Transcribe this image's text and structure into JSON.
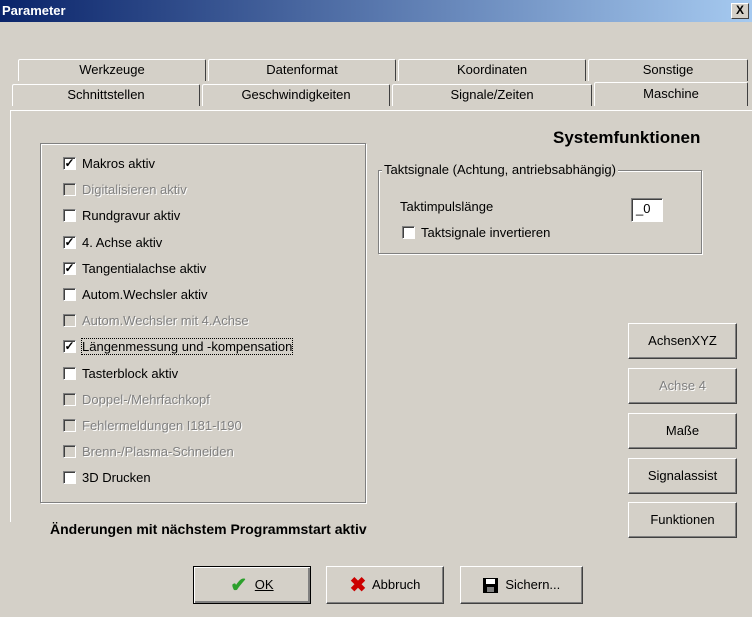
{
  "window": {
    "title": "Parameter",
    "close_glyph": "X"
  },
  "tabs_row1": [
    {
      "label": "Werkzeuge"
    },
    {
      "label": "Datenformat"
    },
    {
      "label": "Koordinaten"
    },
    {
      "label": "Sonstige"
    }
  ],
  "tabs_row2": [
    {
      "label": "Schnittstellen"
    },
    {
      "label": "Geschwindigkeiten"
    },
    {
      "label": "Signale/Zeiten"
    },
    {
      "label": "Maschine",
      "active": true
    }
  ],
  "section_title": "Systemfunktionen",
  "checkboxes": [
    {
      "label": "Makros aktiv",
      "checked": true,
      "enabled": true
    },
    {
      "label": "Digitalisieren aktiv",
      "checked": false,
      "enabled": false
    },
    {
      "label": "Rundgravur aktiv",
      "checked": false,
      "enabled": true
    },
    {
      "label": "4. Achse aktiv",
      "checked": true,
      "enabled": true
    },
    {
      "label": "Tangentialachse aktiv",
      "checked": true,
      "enabled": true
    },
    {
      "label": "Autom.Wechsler aktiv",
      "checked": false,
      "enabled": true
    },
    {
      "label": "Autom.Wechsler mit 4.Achse",
      "checked": false,
      "enabled": false
    },
    {
      "label": "Längenmessung und -kompensation",
      "checked": true,
      "enabled": true,
      "focused": true
    },
    {
      "label": "Tasterblock aktiv",
      "checked": false,
      "enabled": true
    },
    {
      "label": "Doppel-/Mehrfachkopf",
      "checked": false,
      "enabled": false
    },
    {
      "label": "Fehlermeldungen I181-I190",
      "checked": false,
      "enabled": false
    },
    {
      "label": "Brenn-/Plasma-Schneiden",
      "checked": false,
      "enabled": false
    },
    {
      "label": "3D Drucken",
      "checked": false,
      "enabled": true
    }
  ],
  "takt": {
    "group_label": "Taktsignale (Achtung, antriebsabhängig)",
    "pulse_label": "Taktimpulslänge",
    "pulse_value": "_0",
    "invert_label": "Taktsignale invertieren",
    "invert_checked": false
  },
  "side_buttons": [
    {
      "label": "AchsenXYZ",
      "enabled": true
    },
    {
      "label": "Achse 4",
      "enabled": false
    },
    {
      "label": "Maße",
      "enabled": true
    },
    {
      "label": "Signalassist",
      "enabled": true
    },
    {
      "label": "Funktionen",
      "enabled": true
    }
  ],
  "notice": "Änderungen mit nächstem Programmstart aktiv",
  "bottom_buttons": {
    "ok_label": "OK",
    "cancel_label": "Abbruch",
    "save_label": "Sichern..."
  },
  "colors": {
    "face": "#d4d0c8",
    "titlebar_start": "#0a246a",
    "titlebar_end": "#a6caf0",
    "ok_icon": "#2ca02c",
    "cancel_icon": "#cc0000"
  },
  "icons": {
    "ok": "check-icon",
    "cancel": "x-icon",
    "save": "floppy-disk-icon"
  }
}
